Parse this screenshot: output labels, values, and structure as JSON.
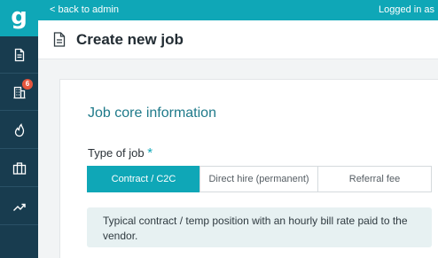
{
  "brand": {
    "logo_letter": "g"
  },
  "sidebar": {
    "items": [
      {
        "name": "documents",
        "icon": "document-icon"
      },
      {
        "name": "companies",
        "icon": "building-icon",
        "badge": "6"
      },
      {
        "name": "hot",
        "icon": "flame-icon"
      },
      {
        "name": "jobs",
        "icon": "briefcase-icon"
      },
      {
        "name": "reports",
        "icon": "trending-icon"
      }
    ]
  },
  "topbar": {
    "back_link": "< back to admin",
    "logged_in": "Logged in as"
  },
  "header": {
    "title": "Create new job",
    "icon": "document-icon"
  },
  "form": {
    "section_title": "Job core information",
    "type_label": "Type of job",
    "required_mark": "*",
    "job_types": [
      "Contract / C2C",
      "Direct hire (permanent)",
      "Referral fee"
    ],
    "selected_type": "Contract / C2C",
    "info_text": "Typical contract / temp position with an hourly bill rate paid to the vendor."
  },
  "colors": {
    "accent": "#0fa7b7",
    "sidebar": "#183c4f",
    "badge": "#e5553d",
    "info_bg": "#e7f1f2"
  }
}
